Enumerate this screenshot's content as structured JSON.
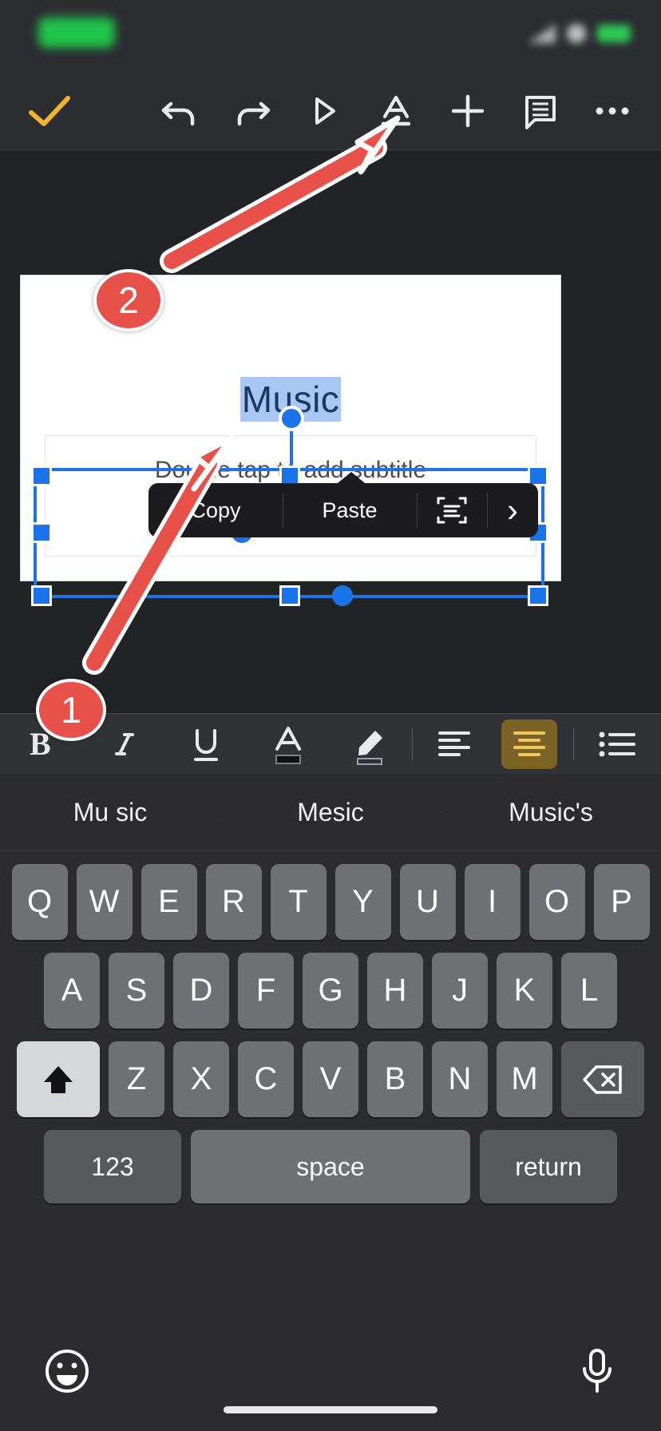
{
  "app": {
    "name": "Google Slides (mobile editor)"
  },
  "status_bar": {
    "carrier_badge": "",
    "icons": [
      "signal-icon",
      "wifi-icon",
      "battery-icon"
    ]
  },
  "toolbar": {
    "accept_label": "✓",
    "items": [
      {
        "name": "accept-button",
        "icon": "check-icon"
      },
      {
        "name": "undo-button",
        "icon": "undo-icon"
      },
      {
        "name": "redo-button",
        "icon": "redo-icon"
      },
      {
        "name": "present-button",
        "icon": "play-icon"
      },
      {
        "name": "text-format-button",
        "icon": "text-format-a-icon"
      },
      {
        "name": "insert-button",
        "icon": "plus-icon"
      },
      {
        "name": "comment-button",
        "icon": "comment-icon"
      },
      {
        "name": "more-options-button",
        "icon": "ellipsis-icon"
      }
    ]
  },
  "slide": {
    "title_text": "Music",
    "subtitle_placeholder": "Double tap to add subtitle",
    "title_selected": true
  },
  "context_menu": {
    "items": [
      {
        "label": "Copy",
        "name": "copy-menu-item"
      },
      {
        "label": "Paste",
        "name": "paste-menu-item"
      }
    ],
    "scan_icon": "scan-text-icon",
    "chevron": "›"
  },
  "annotations": [
    {
      "number": "1",
      "name": "annotation-badge-1",
      "points_to": "format-toolbar-align-center"
    },
    {
      "number": "2",
      "name": "annotation-badge-2",
      "points_to": "toolbar-insert-plus"
    }
  ],
  "format_toolbar": {
    "items": [
      {
        "name": "bold-button",
        "label": "B",
        "active": false
      },
      {
        "name": "italic-button",
        "label": "I",
        "active": false
      },
      {
        "name": "underline-button",
        "label": "U",
        "active": false
      },
      {
        "name": "text-color-button",
        "label": "A",
        "active": false
      },
      {
        "name": "highlight-button",
        "label": "highlighter-icon",
        "active": false
      },
      {
        "name": "align-left-button",
        "label": "align-left-icon",
        "active": false
      },
      {
        "name": "align-center-button",
        "label": "align-center-icon",
        "active": true
      },
      {
        "name": "bulleted-list-button",
        "label": "bulleted-list-icon",
        "active": false
      }
    ],
    "active_color": "#d9a62e",
    "active_bg": "#7a6323"
  },
  "keyboard": {
    "suggestions": [
      "Mu sic",
      "Mesic",
      "Music's"
    ],
    "row1": [
      "Q",
      "W",
      "E",
      "R",
      "T",
      "Y",
      "U",
      "I",
      "O",
      "P"
    ],
    "row2": [
      "A",
      "S",
      "D",
      "F",
      "G",
      "H",
      "J",
      "K",
      "L"
    ],
    "row3": [
      "Z",
      "X",
      "C",
      "V",
      "B",
      "N",
      "M"
    ],
    "shift_label": "shift-icon",
    "backspace_label": "backspace-icon",
    "numbers_key": "123",
    "space_key": "space",
    "return_key": "return",
    "emoji_key": "emoji-icon",
    "mic_key": "microphone-icon"
  },
  "colors": {
    "accent_blue": "#1a73e8",
    "annotation_red": "#e8504a",
    "selection_highlight": "#a8c7f5",
    "toolbar_bg": "#2b2d30",
    "canvas_bg": "#212325"
  }
}
